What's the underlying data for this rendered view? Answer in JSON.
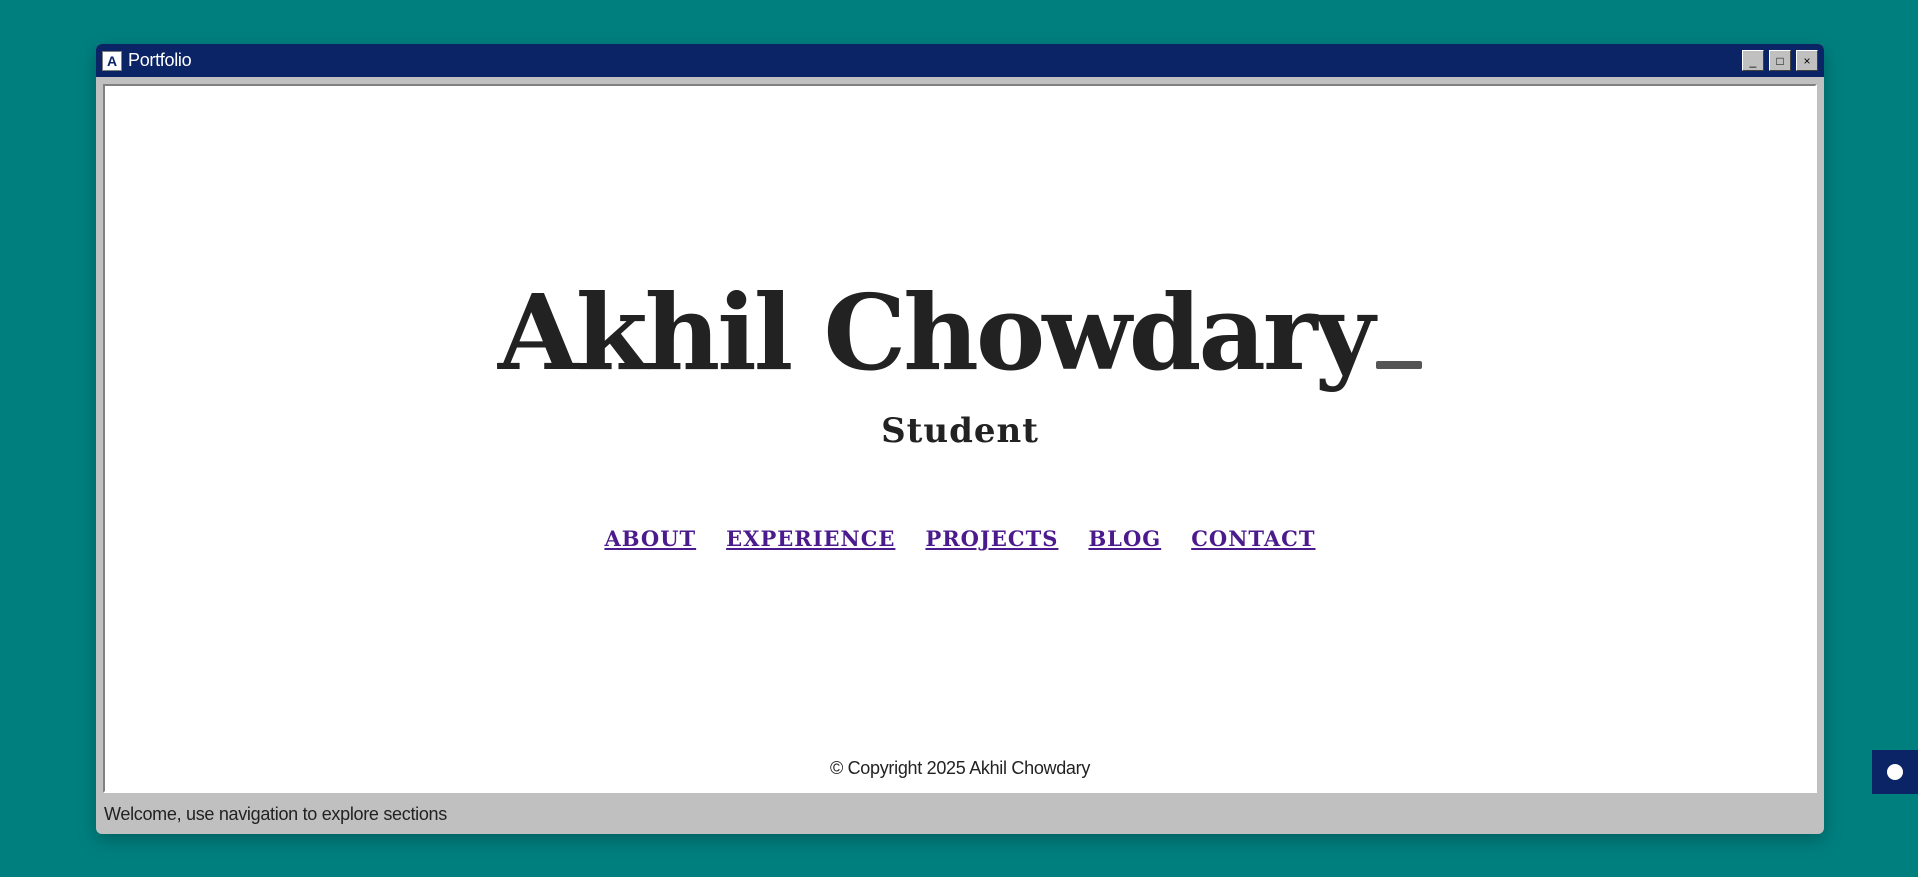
{
  "window": {
    "title": "Portfolio",
    "icon_letter": "A",
    "buttons": {
      "minimize": "_",
      "maximize": "□",
      "close": "×"
    }
  },
  "hero": {
    "name": "Akhil Chowdary",
    "role": "Student"
  },
  "nav": {
    "items": [
      {
        "label": "ABOUT"
      },
      {
        "label": "EXPERIENCE"
      },
      {
        "label": "PROJECTS"
      },
      {
        "label": "BLOG"
      },
      {
        "label": "CONTACT"
      }
    ]
  },
  "footer": {
    "copyright": "© Copyright 2025 Akhil Chowdary"
  },
  "statusbar": {
    "text": "Welcome, use navigation to explore sections"
  },
  "colors": {
    "desktop": "#007f7f",
    "titlebar": "#0a2466",
    "link": "#4b1a8c"
  }
}
